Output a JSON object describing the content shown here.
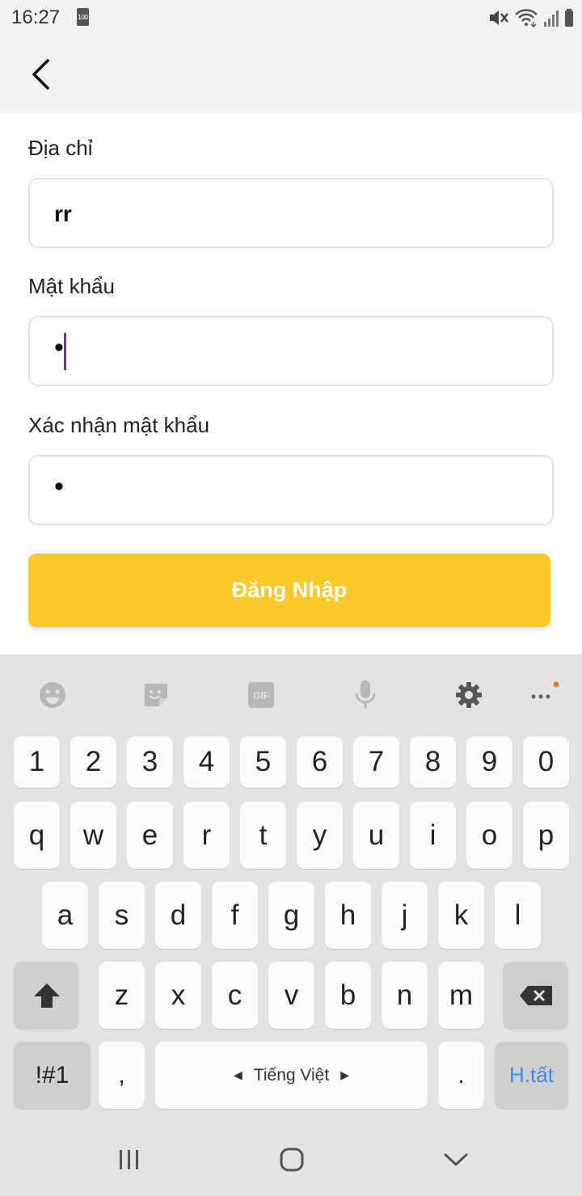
{
  "status_bar": {
    "time": "16:27",
    "battery_small": "100",
    "icons": [
      "mute-icon",
      "wifi-icon",
      "signal-icon",
      "battery-icon"
    ]
  },
  "app_bar": {
    "back_icon": "chevron-left-icon"
  },
  "form": {
    "address_label": "Địa chỉ",
    "address_value": "rr",
    "password_label": "Mật khẩu",
    "password_value": "•",
    "confirm_label": "Xác nhận mật khẩu",
    "confirm_value": "•",
    "login_button": "Đăng Nhập",
    "accent_color": "#fdc829"
  },
  "keyboard": {
    "toolbar": [
      "emoji-icon",
      "sticker-icon",
      "gif-icon",
      "microphone-icon",
      "settings-icon",
      "more-icon"
    ],
    "gif_label": "GIF",
    "number_row": [
      "1",
      "2",
      "3",
      "4",
      "5",
      "6",
      "7",
      "8",
      "9",
      "0"
    ],
    "row1": [
      "q",
      "w",
      "e",
      "r",
      "t",
      "y",
      "u",
      "i",
      "o",
      "p"
    ],
    "row2": [
      "a",
      "s",
      "d",
      "f",
      "g",
      "h",
      "j",
      "k",
      "l"
    ],
    "row3": [
      "z",
      "x",
      "c",
      "v",
      "b",
      "n",
      "m"
    ],
    "symbols_key": "!#1",
    "comma_key": ",",
    "space_label": "Tiếng Việt",
    "period_key": ".",
    "done_key": "H.tất",
    "done_color": "#3a8ee6"
  },
  "nav_bar": {
    "icons": [
      "recent-apps-icon",
      "home-icon",
      "back-nav-icon"
    ]
  }
}
